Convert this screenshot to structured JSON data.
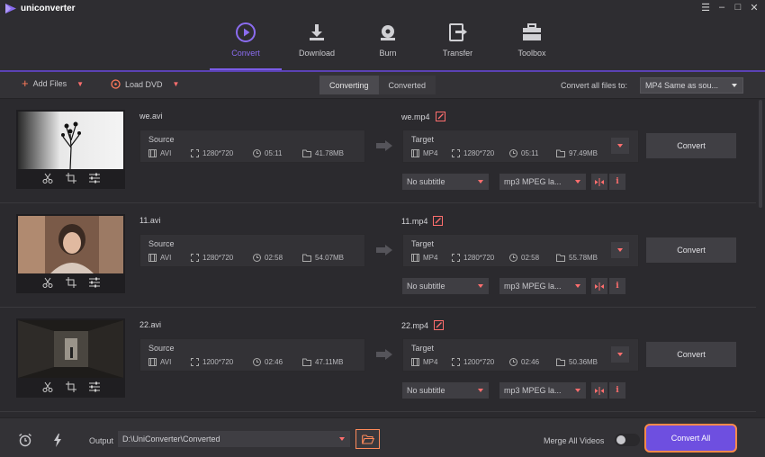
{
  "app": {
    "name": "uniconverter"
  },
  "window": {
    "minimize": "–",
    "maximize": "□",
    "close": "✕",
    "menu": "☰"
  },
  "nav": [
    {
      "label": "Convert",
      "icon": "play-circle-icon",
      "active": true
    },
    {
      "label": "Download",
      "icon": "download-icon"
    },
    {
      "label": "Burn",
      "icon": "disc-burn-icon"
    },
    {
      "label": "Transfer",
      "icon": "transfer-icon"
    },
    {
      "label": "Toolbox",
      "icon": "toolbox-icon"
    }
  ],
  "toolbar": {
    "add_files": "Add Files",
    "load_dvd": "Load DVD",
    "tabs": [
      "Converting",
      "Converted"
    ],
    "convert_all_to_label": "Convert all files to:",
    "convert_all_to_value": "MP4 Same as sou..."
  },
  "source_label": "Source",
  "target_label": "Target",
  "convert_label": "Convert",
  "files": [
    {
      "source_name": "we.avi",
      "target_name": "we.mp4",
      "source": {
        "format": "AVI",
        "resolution": "1280*720",
        "duration": "05:11",
        "size": "41.78MB"
      },
      "target": {
        "format": "MP4",
        "resolution": "1280*720",
        "duration": "05:11",
        "size": "97.49MB"
      },
      "subtitle": "No subtitle",
      "audio": "mp3 MPEG la..."
    },
    {
      "source_name": "11.avi",
      "target_name": "11.mp4",
      "source": {
        "format": "AVI",
        "resolution": "1280*720",
        "duration": "02:58",
        "size": "54.07MB"
      },
      "target": {
        "format": "MP4",
        "resolution": "1280*720",
        "duration": "02:58",
        "size": "55.78MB"
      },
      "subtitle": "No subtitle",
      "audio": "mp3 MPEG la..."
    },
    {
      "source_name": "22.avi",
      "target_name": "22.mp4",
      "source": {
        "format": "AVI",
        "resolution": "1200*720",
        "duration": "02:46",
        "size": "47.11MB"
      },
      "target": {
        "format": "MP4",
        "resolution": "1200*720",
        "duration": "02:46",
        "size": "50.36MB"
      },
      "subtitle": "No subtitle",
      "audio": "mp3 MPEG la..."
    }
  ],
  "bottom": {
    "output_label": "Output",
    "output_path": "D:\\UniConverter\\Converted",
    "merge_label": "Merge All Videos",
    "merge_enabled": false,
    "convert_all": "Convert All"
  },
  "colors": {
    "accent": "#7b5ce8",
    "highlight": "#ff6e6e",
    "convert_all_border": "#ff8a4a"
  }
}
